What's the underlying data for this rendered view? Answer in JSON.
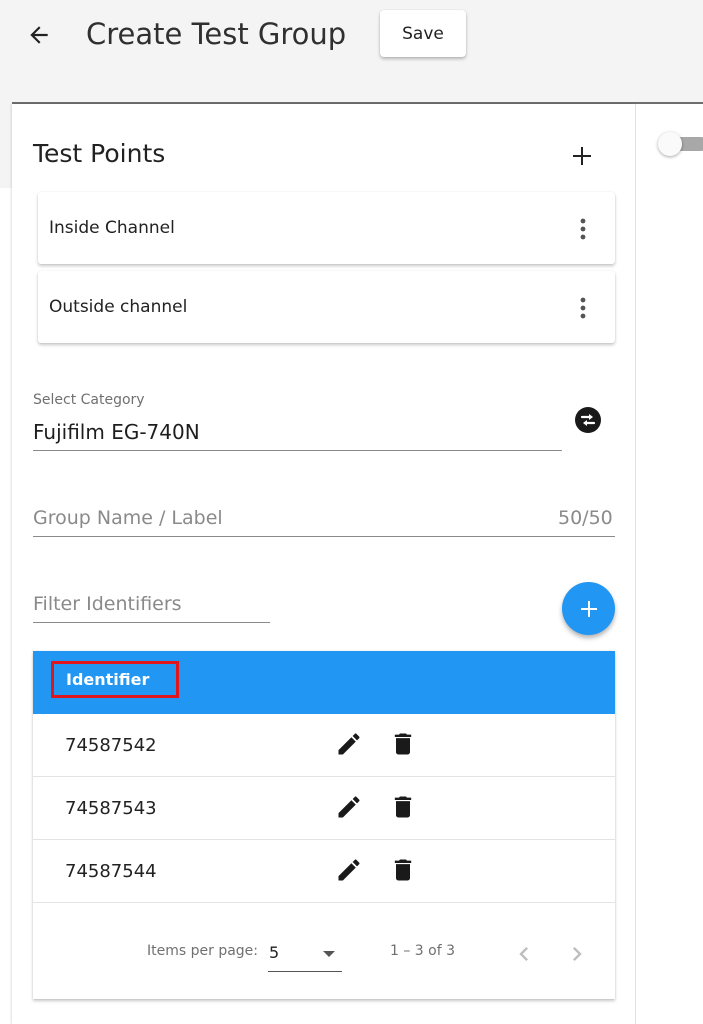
{
  "header": {
    "title": "Create Test Group",
    "save_label": "Save"
  },
  "test_points": {
    "title": "Test Points",
    "items": [
      {
        "label": "Inside Channel"
      },
      {
        "label": "Outside channel"
      }
    ]
  },
  "category": {
    "label": "Select Category",
    "value": "Fujifilm EG-740N"
  },
  "group_name": {
    "placeholder": "Group Name / Label",
    "counter": "50/50"
  },
  "filter": {
    "placeholder": "Filter Identifiers"
  },
  "table": {
    "header": "Identifier",
    "rows": [
      {
        "identifier": "74587542"
      },
      {
        "identifier": "74587543"
      },
      {
        "identifier": "74587544"
      }
    ]
  },
  "paginator": {
    "items_per_page_label": "Items per page:",
    "page_size": "5",
    "range_label": "1 – 3 of 3"
  },
  "colors": {
    "accent": "#2196f3",
    "highlight_border": "#e0161e"
  }
}
